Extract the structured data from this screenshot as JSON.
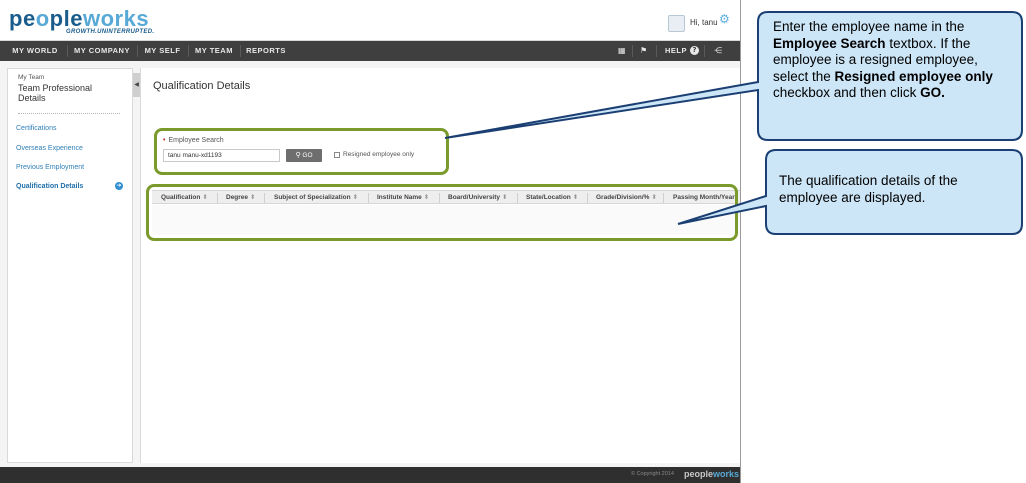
{
  "header": {
    "logo_part1": "pe",
    "logo_part2": "o",
    "logo_part3": "ple",
    "logo_part4": "w",
    "logo_part5": "o",
    "logo_part6": "rks",
    "tagline": "GROWTH.UNINTERRUPTED.",
    "greeting": "Hi, tanu"
  },
  "nav": {
    "items": [
      "MY WORLD",
      "MY COMPANY",
      "MY SELF",
      "MY TEAM",
      "REPORTS"
    ],
    "help": "HELP"
  },
  "sidebar": {
    "breadcrumb": "My Team",
    "title": "Team Professional Details",
    "links": [
      "Certifications",
      "Overseas Experience",
      "Previous Employment",
      "Qualification Details"
    ]
  },
  "main": {
    "page_title": "Qualification Details",
    "search_label": "Employee Search",
    "search_value": "tanu manu-xd1193",
    "go_label": "GO",
    "resigned_label": "Resigned employee only",
    "columns": [
      "Qualification",
      "Degree",
      "Subject of Specialization",
      "Institute Name",
      "Board/University",
      "State/Location",
      "Grade/Division/%",
      "Passing Month/Year"
    ]
  },
  "footer": {
    "copyright": "© Copyright 2014",
    "logo_a": "people",
    "logo_b": "works"
  },
  "callouts": {
    "c1_part1": "Enter the employee name in the ",
    "c1_bold1": "Employee Search",
    "c1_part2": " textbox.  If the employee is a resigned employee, select the ",
    "c1_bold2": "Resigned employee only",
    "c1_part3": " checkbox and then click ",
    "c1_bold3": "GO.",
    "c2": "The qualification details of the employee are displayed."
  },
  "colors": {
    "highlight": "#7b9a2c",
    "callout_fill": "#cde6f7",
    "callout_border": "#1b3f73",
    "nav_bg": "#3f3f3f",
    "brand_blue": "#1a5d8c",
    "link_blue": "#2f7fb8"
  },
  "icons": [
    "gear-icon",
    "grid-view-icon",
    "flag-icon",
    "help-icon",
    "org-chart-icon",
    "search-icon",
    "arrow-right-icon",
    "collapse-arrow-icon"
  ]
}
